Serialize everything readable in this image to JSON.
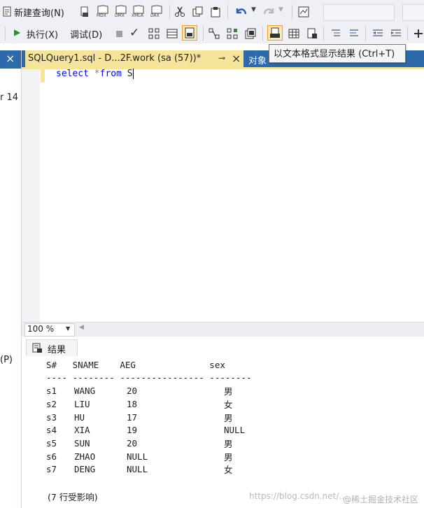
{
  "toolbar1": {
    "new_query_label": "新建查询(N)",
    "mdx_label": "MDX",
    "dmx_label": "DMX",
    "xmla_label": "XMLA",
    "dax_label": "DAX"
  },
  "toolbar2": {
    "execute_label": "执行(X)",
    "debug_label": "调试(D)"
  },
  "tooltip_text": "以文本格式显示结果 (Ctrl+T)",
  "left_panel": {
    "close_glyph": "×",
    "partial_text_1": "r 14",
    "partial_text_2": "(P)"
  },
  "tabs": [
    {
      "label": "SQLQuery1.sql - D...2F.work (sa (57))*",
      "pin_glyph": "⊸",
      "close_glyph": "×"
    },
    {
      "label": "对象"
    }
  ],
  "editor": {
    "code": "select *from S"
  },
  "zoom": {
    "value": "100 %"
  },
  "results": {
    "tab_label": "结果",
    "header_line": "S#   SNAME    AEG              sex",
    "divider_line": "---- -------- ---------------- --------",
    "rows": [
      {
        "sno": "s1",
        "sname": "WANG",
        "aeg": "20",
        "sex": "男"
      },
      {
        "sno": "s2",
        "sname": "LIU",
        "aeg": "18",
        "sex": "女"
      },
      {
        "sno": "s3",
        "sname": "HU",
        "aeg": "17",
        "sex": "男"
      },
      {
        "sno": "s4",
        "sname": "XIA",
        "aeg": "19",
        "sex": "NULL"
      },
      {
        "sno": "s5",
        "sname": "SUN",
        "aeg": "20",
        "sex": "男"
      },
      {
        "sno": "s6",
        "sname": "ZHAO",
        "aeg": "NULL",
        "sex": "男"
      },
      {
        "sno": "s7",
        "sname": "DENG",
        "aeg": "NULL",
        "sex": "女"
      }
    ],
    "rows_affected": "(7 行受影响)"
  },
  "watermark": {
    "url_text": "https://blog.csdn.net/...",
    "brand_text": "@稀土掘金技术社区"
  },
  "colors": {
    "tab_bar": "#2c6aab",
    "active_tab": "#f6e49a",
    "keyword_blue": "#0000ff",
    "operator_gray": "#808080",
    "toolbar_bg": "#eef0f5"
  }
}
